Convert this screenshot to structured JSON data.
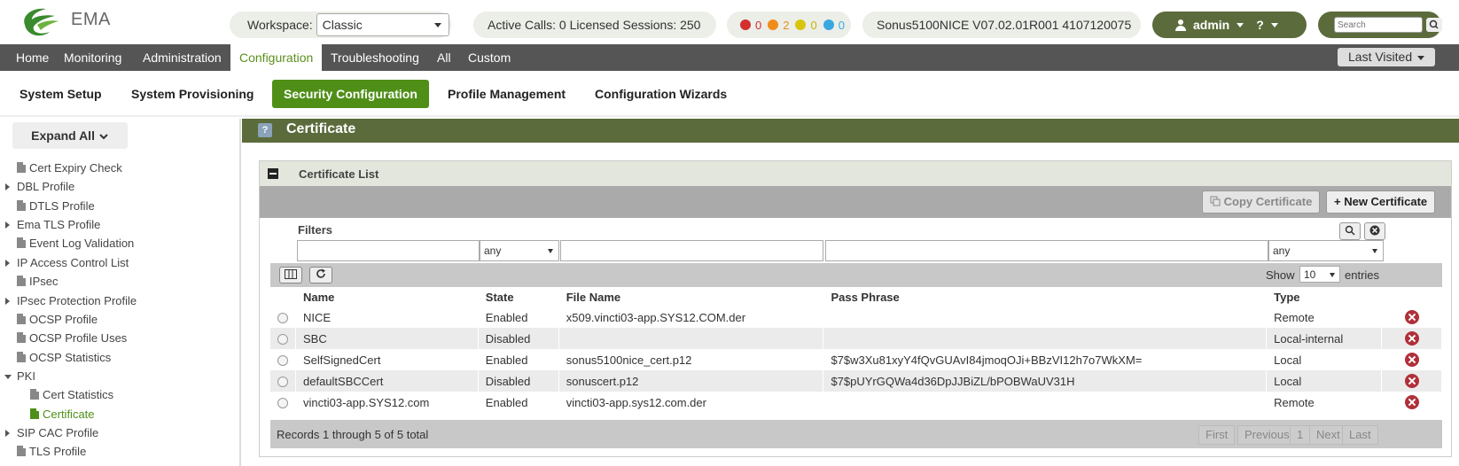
{
  "app": {
    "name": "EMA"
  },
  "header": {
    "workspace_label": "Workspace:",
    "workspace_value": "Classic",
    "sessions_text": "Active Calls: 0 Licensed Sessions: 250",
    "alarms": [
      {
        "count": "0",
        "color": "#d32f2f"
      },
      {
        "count": "2",
        "color": "#f08c1c"
      },
      {
        "count": "0",
        "color": "#d8c40c"
      },
      {
        "count": "0",
        "color": "#39a8e0"
      }
    ],
    "system_info": "Sonus5100NICE V07.02.01R001 4107120075",
    "user_label": "admin",
    "help_label": "?",
    "search_placeholder": "Search"
  },
  "main_nav": {
    "items": [
      "Home",
      "Monitoring",
      "Administration",
      "Configuration",
      "Troubleshooting",
      "All",
      "Custom"
    ],
    "active": "Configuration",
    "last_visited": "Last Visited"
  },
  "sub_nav": {
    "items": [
      "System Setup",
      "System Provisioning",
      "Security Configuration",
      "Profile Management",
      "Configuration Wizards"
    ],
    "active": "Security Configuration"
  },
  "sidebar": {
    "expand_label": "Expand All",
    "items": [
      {
        "label": "Cert Expiry Check",
        "kind": "leaf"
      },
      {
        "label": "DBL Profile",
        "kind": "folder"
      },
      {
        "label": "DTLS Profile",
        "kind": "leaf"
      },
      {
        "label": "Ema TLS Profile",
        "kind": "folder"
      },
      {
        "label": "Event Log Validation",
        "kind": "leaf"
      },
      {
        "label": "IP Access Control List",
        "kind": "folder"
      },
      {
        "label": "IPsec",
        "kind": "leaf"
      },
      {
        "label": "IPsec Protection Profile",
        "kind": "folder"
      },
      {
        "label": "OCSP Profile",
        "kind": "leaf"
      },
      {
        "label": "OCSP Profile Uses",
        "kind": "leaf"
      },
      {
        "label": "OCSP Statistics",
        "kind": "leaf"
      },
      {
        "label": "PKI",
        "kind": "open"
      },
      {
        "label": "Cert Statistics",
        "kind": "child"
      },
      {
        "label": "Certificate",
        "kind": "child-selected"
      },
      {
        "label": "SIP CAC Profile",
        "kind": "folder"
      },
      {
        "label": "TLS Profile",
        "kind": "leaf"
      }
    ]
  },
  "page": {
    "title": "Certificate",
    "help": "?",
    "panel_title": "Certificate List",
    "copy_button": "Copy Certificate",
    "new_button": "+ New Certificate",
    "filters_label": "Filters",
    "filter_state_value": "any",
    "filter_type_value": "any",
    "show_label": "Show",
    "show_value": "10",
    "entries_label": "entries",
    "columns": [
      "Name",
      "State",
      "File Name",
      "Pass Phrase",
      "Type"
    ],
    "rows": [
      {
        "name": "NICE",
        "state": "Enabled",
        "file": "x509.vincti03-app.SYS12.COM.der",
        "pass": "",
        "type": "Remote"
      },
      {
        "name": "SBC",
        "state": "Disabled",
        "file": "",
        "pass": "",
        "type": "Local-internal"
      },
      {
        "name": "SelfSignedCert",
        "state": "Enabled",
        "file": "sonus5100nice_cert.p12",
        "pass": "$7$w3Xu81xyY4fQvGUAvI84jmoqOJi+BBzVI12h7o7WkXM=",
        "type": "Local"
      },
      {
        "name": "defaultSBCCert",
        "state": "Disabled",
        "file": "sonuscert.p12",
        "pass": "$7$pUYrGQWa4d36DpJJBiZL/bPOBWaUV31H",
        "type": "Local"
      },
      {
        "name": "vincti03-app.SYS12.com",
        "state": "Enabled",
        "file": "vincti03-app.sys12.com.der",
        "pass": "",
        "type": "Remote"
      }
    ],
    "records_text": "Records 1 through 5 of 5 total",
    "pager": [
      "First",
      "Previous",
      "1",
      "Next",
      "Last"
    ]
  },
  "colors": {
    "brand_green": "#4f8f18",
    "header_olive": "#5b6b3b",
    "nav_gray": "#555555",
    "delete_red": "#b0303a"
  }
}
